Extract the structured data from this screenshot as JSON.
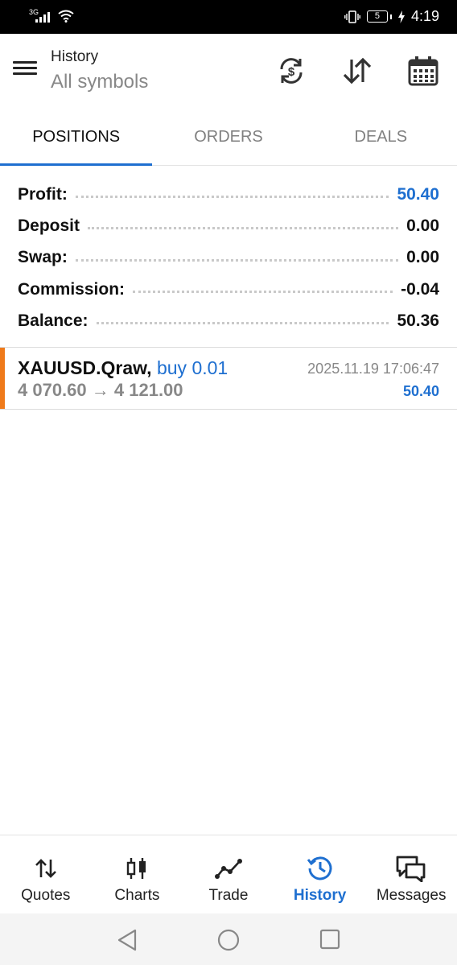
{
  "status_bar": {
    "network": "3G",
    "battery": "5",
    "time": "4:19"
  },
  "header": {
    "title": "History",
    "subtitle": "All symbols",
    "icons": [
      "currency-sync-icon",
      "sort-icon",
      "calendar-icon"
    ]
  },
  "tabs": [
    {
      "label": "POSITIONS",
      "active": true
    },
    {
      "label": "ORDERS",
      "active": false
    },
    {
      "label": "DEALS",
      "active": false
    }
  ],
  "summary": [
    {
      "label": "Profit:",
      "value": "50.40"
    },
    {
      "label": "Deposit",
      "value": "0.00"
    },
    {
      "label": "Swap:",
      "value": "0.00"
    },
    {
      "label": "Commission:",
      "value": "-0.04"
    },
    {
      "label": "Balance:",
      "value": "50.36"
    }
  ],
  "positions": [
    {
      "symbol": "XAUUSD.Qraw,",
      "side": "buy 0.01",
      "time": "2025.11.19 17:06:47",
      "open_price": "4 070.60",
      "arrow": "→",
      "close_price": "4 121.00",
      "profit": "50.40"
    }
  ],
  "bottom_nav": [
    {
      "label": "Quotes",
      "icon": "quotes-icon",
      "active": false
    },
    {
      "label": "Charts",
      "icon": "charts-icon",
      "active": false
    },
    {
      "label": "Trade",
      "icon": "trade-icon",
      "active": false
    },
    {
      "label": "History",
      "icon": "history-icon",
      "active": true
    },
    {
      "label": "Messages",
      "icon": "messages-icon",
      "active": false
    }
  ],
  "colors": {
    "accent": "#1e6fd0",
    "position_buy_marker": "#ef7a1a"
  }
}
